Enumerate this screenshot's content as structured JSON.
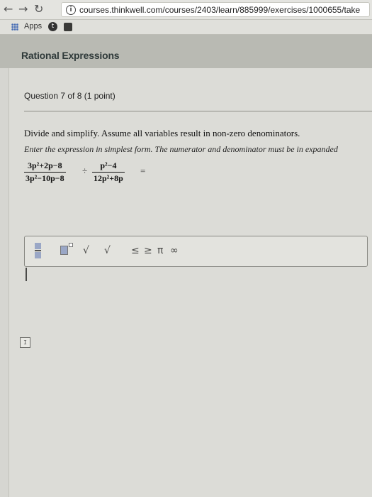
{
  "browser": {
    "url": "courses.thinkwell.com/courses/2403/learn/885999/exercises/1000655/take",
    "bookmarks": {
      "apps_label": "Apps",
      "item_icon": "t"
    }
  },
  "page": {
    "title": "Rational Expressions",
    "question_header": "Question 7 of 8 (1 point)",
    "instruction": "Divide and simplify. Assume all variables result in non-zero denominators.",
    "instruction_italic": "Enter the expression in simplest form. The numerator and denominator must be in expanded"
  },
  "expression": {
    "frac1_num": "3p²+2p−8",
    "frac1_den": "3p²−10p−8",
    "divide": "÷",
    "frac2_num": "p²−4",
    "frac2_den": "12p²+8p",
    "equals": "="
  },
  "toolbar": {
    "sqrt": "√",
    "nth_root": "√",
    "le": "≤",
    "ge": "≥",
    "pi": "π",
    "infinity": "∞"
  },
  "footer": {
    "box_label": "I"
  }
}
